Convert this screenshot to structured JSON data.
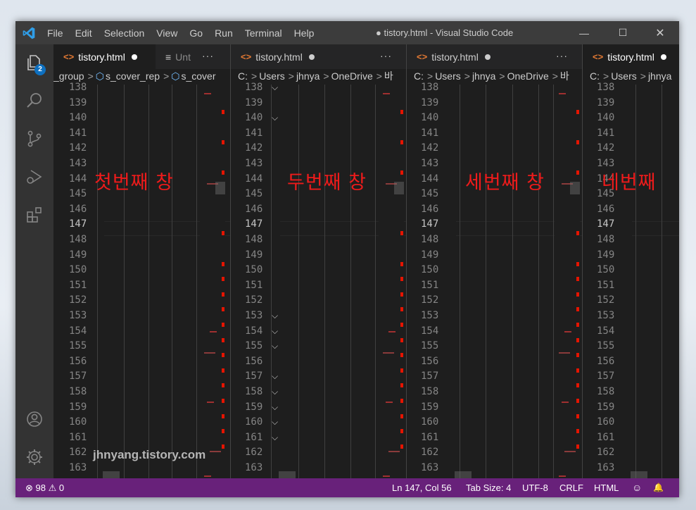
{
  "titlebar": {
    "menus": [
      "File",
      "Edit",
      "Selection",
      "View",
      "Go",
      "Run",
      "Terminal",
      "Help"
    ],
    "title": "● tistory.html - Visual Studio Code",
    "minimize": "—",
    "maximize": "☐",
    "close": "✕"
  },
  "activity": {
    "explorer_badge": "2"
  },
  "groups": [
    {
      "tabs": [
        {
          "icon": "<>",
          "label": "tistory.html"
        },
        {
          "icon": "≡",
          "label": "Unt"
        }
      ],
      "more": "···",
      "crumbs": [
        "_group",
        "s_cover_rep",
        "s_cover"
      ],
      "overlay": "첫번째 창"
    },
    {
      "tabs": [
        {
          "icon": "<>",
          "label": "tistory.html"
        }
      ],
      "more": "···",
      "crumbs": [
        "C:",
        "Users",
        "jhnya",
        "OneDrive",
        "바"
      ],
      "overlay": "두번째 창"
    },
    {
      "tabs": [
        {
          "icon": "<>",
          "label": "tistory.html"
        }
      ],
      "more": "···",
      "crumbs": [
        "C:",
        "Users",
        "jhnya",
        "OneDrive",
        "바"
      ],
      "overlay": "세번째 창"
    },
    {
      "tabs": [
        {
          "icon": "<>",
          "label": "tistory.html"
        }
      ],
      "more": "",
      "crumbs": [
        "C:",
        "Users",
        "jhnya"
      ],
      "overlay": "네번째"
    }
  ],
  "line_numbers": [
    "138",
    "139",
    "140",
    "141",
    "142",
    "143",
    "144",
    "145",
    "146",
    "147",
    "148",
    "149",
    "150",
    "151",
    "152",
    "153",
    "154",
    "155",
    "156",
    "157",
    "158",
    "159",
    "160",
    "161",
    "162",
    "163"
  ],
  "current_line": "147",
  "watermark": "jhnyang.tistory.com",
  "statusbar": {
    "problems": "⊗ 98 ⚠ 0",
    "position": "Ln 147, Col 56",
    "tab_size": "Tab Size: 4",
    "encoding": "UTF-8",
    "eol": "CRLF",
    "language": "HTML",
    "feedback": "☺",
    "bell": "🔔"
  },
  "colors": {
    "statusbar": "#68217a",
    "titlebar": "#3c3c3c",
    "activitybar": "#333333",
    "editor": "#1e1e1e",
    "overlay_text": "#ee1b1b",
    "html_icon": "#e37933"
  }
}
